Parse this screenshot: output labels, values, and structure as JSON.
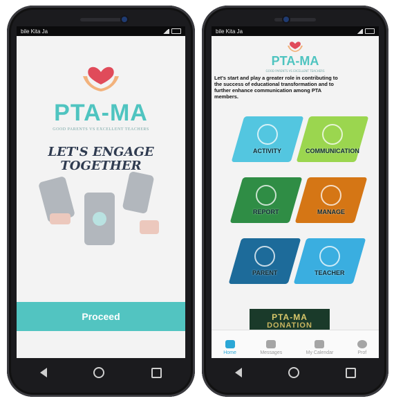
{
  "left_phone": {
    "status_text": "bile Kita Ja",
    "brand_title": "PTA-MA",
    "brand_subtitle": "GOOD PARENTS VS EXCELLENT TEACHERS",
    "tagline_line1": "LET'S ENGAGE",
    "tagline_line2": "TOGETHER",
    "proceed_label": "Proceed"
  },
  "right_phone": {
    "status_text": "bile Kita Ja",
    "brand_title": "PTA-MA",
    "brand_subtitle": "GOOD PARENTS VS EXCELLENT TEACHERS",
    "intro": "Let's start and play a greater role in contributing to\nthe success of educational transformation and to\nfurther enhance communication among PTA\nmembers.",
    "tiles": [
      {
        "label": "ACTIVITY",
        "color": "#53c6e0"
      },
      {
        "label": "COMMUNICATION",
        "color": "#9bd64f"
      },
      {
        "label": "REPORT",
        "color": "#2f8d45"
      },
      {
        "label": "MANAGE",
        "color": "#d57615"
      },
      {
        "label": "PARENT",
        "color": "#1d6b9a"
      },
      {
        "label": "TEACHER",
        "color": "#3aaee0"
      }
    ],
    "donation_line1": "PTA-MA",
    "donation_line2": "DONATION",
    "tabs": [
      {
        "label": "Home",
        "icon": "home-icon"
      },
      {
        "label": "Messages",
        "icon": "messages-icon"
      },
      {
        "label": "My Calendar",
        "icon": "calendar-icon"
      },
      {
        "label": "Prof",
        "icon": "profile-icon"
      }
    ]
  }
}
